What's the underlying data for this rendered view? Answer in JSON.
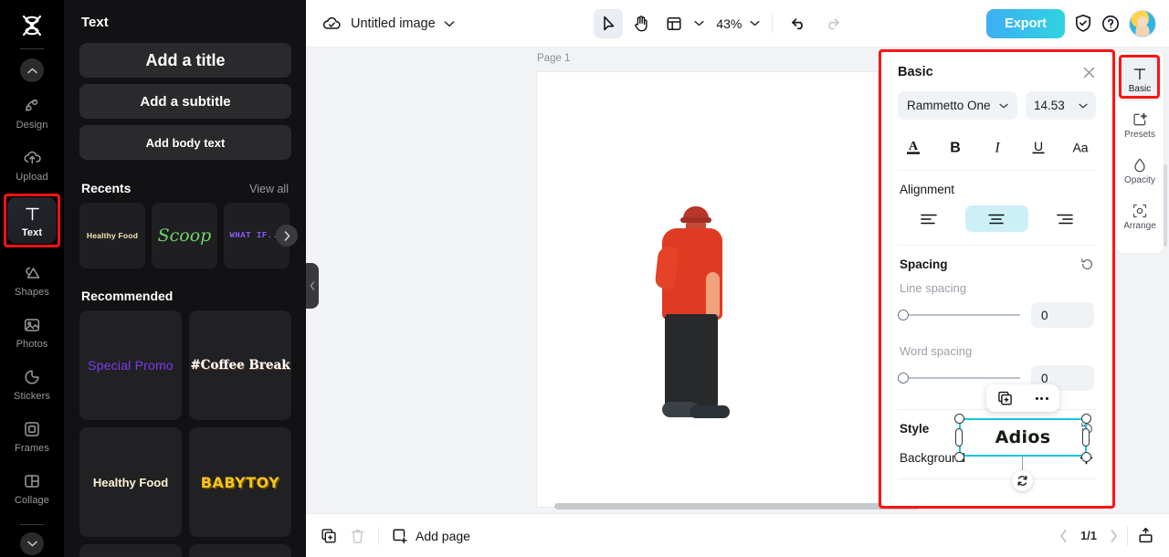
{
  "app": {
    "logo_icon": "capcut-logo-icon"
  },
  "left_rail": {
    "collapse_up_icon": "chevron-up-icon",
    "collapse_down_icon": "chevron-down-icon",
    "items": [
      {
        "label": "Design",
        "icon": "design-icon"
      },
      {
        "label": "Upload",
        "icon": "upload-cloud-icon"
      },
      {
        "label": "Text",
        "icon": "text-T-icon",
        "active": true,
        "highlighted": true
      },
      {
        "label": "Shapes",
        "icon": "shapes-icon"
      },
      {
        "label": "Photos",
        "icon": "photos-image-icon"
      },
      {
        "label": "Stickers",
        "icon": "stickers-icon"
      },
      {
        "label": "Frames",
        "icon": "frames-icon"
      },
      {
        "label": "Collage",
        "icon": "collage-icon"
      }
    ]
  },
  "text_panel": {
    "title": "Text",
    "buttons": [
      {
        "label": "Add a title"
      },
      {
        "label": "Add a subtitle"
      },
      {
        "label": "Add body text"
      }
    ],
    "recents": {
      "title": "Recents",
      "view_all": "View all",
      "next_icon": "chevron-right-icon",
      "items": [
        {
          "label": "Healthy Food",
          "color": "#f7e6b0"
        },
        {
          "label": "Scoop",
          "color": "#72d36b"
        },
        {
          "label": "WHAT IF...",
          "color": "#8b5cf6"
        }
      ]
    },
    "recommended": {
      "title": "Recommended",
      "items": [
        {
          "label": "Special Promo",
          "color": "#7c3aed"
        },
        {
          "label": "#Coffee Break",
          "color": "#ffffff"
        },
        {
          "label": "Healthy Food",
          "color": "#fdf3d0"
        },
        {
          "label": "BABYTOY",
          "color": "#f5c518"
        }
      ]
    },
    "collapse_icon": "chevron-left-icon"
  },
  "topbar": {
    "cloud_icon": "cloud-check-icon",
    "doc_title": "Untitled image",
    "title_chevron_icon": "chevron-down-icon",
    "tools": [
      {
        "name": "select-tool",
        "icon": "cursor-arrow-icon",
        "selected": true
      },
      {
        "name": "hand-tool",
        "icon": "hand-icon",
        "selected": false
      },
      {
        "name": "layout-tool",
        "icon": "layout-panel-icon",
        "selected": false
      }
    ],
    "layout_chevron_icon": "chevron-down-icon",
    "zoom_value": "43%",
    "zoom_chevron_icon": "chevron-down-icon",
    "undo_icon": "undo-arrow-icon",
    "redo_icon": "redo-arrow-icon",
    "export_label": "Export",
    "shield_icon": "shield-check-icon",
    "help_icon": "question-circle-icon",
    "avatar_name": "user-avatar"
  },
  "canvas": {
    "page_label": "Page 1",
    "selected_text": "Adios",
    "floating_toolbar": {
      "duplicate_icon": "duplicate-icon",
      "more_icon": "more-dots-icon"
    },
    "rotate_icon": "rotate-icon"
  },
  "bottombar": {
    "duplicate_page_icon": "duplicate-page-icon",
    "delete_page_icon": "trash-icon",
    "add_page_icon": "add-page-icon",
    "add_page_label": "Add page",
    "prev_icon": "chevron-left-icon",
    "page_indicator": "1/1",
    "next_icon": "chevron-right-icon",
    "present_icon": "present-icon"
  },
  "properties_panel": {
    "title": "Basic",
    "close_icon": "close-x-icon",
    "font_family": "Rammetto One",
    "font_family_chevron": "chevron-down-icon",
    "font_size": "14.53",
    "font_size_chevron": "chevron-down-icon",
    "format_buttons": [
      {
        "name": "text-color-button",
        "label": "A"
      },
      {
        "name": "bold-button",
        "label": "B"
      },
      {
        "name": "italic-button",
        "label": "I"
      },
      {
        "name": "underline-button",
        "label": "U"
      },
      {
        "name": "text-case-button",
        "label": "Aa"
      }
    ],
    "alignment": {
      "label": "Alignment",
      "options": [
        {
          "name": "align-left-button",
          "selected": false
        },
        {
          "name": "align-center-button",
          "selected": true
        },
        {
          "name": "align-right-button",
          "selected": false
        }
      ]
    },
    "spacing": {
      "title": "Spacing",
      "reset_icon": "reset-icon",
      "line_spacing_label": "Line spacing",
      "line_spacing_value": "0",
      "word_spacing_label": "Word spacing",
      "word_spacing_value": "0"
    },
    "style": {
      "title": "Style",
      "reset_icon": "reset-icon",
      "background_label": "Background",
      "add_icon": "plus-icon"
    },
    "highlight_color": "#ff1313"
  },
  "right_rail": {
    "items": [
      {
        "label": "Basic",
        "icon": "text-T-icon",
        "active": true,
        "highlighted": true
      },
      {
        "label": "Presets",
        "icon": "presets-icon",
        "active": false
      },
      {
        "label": "Opacity",
        "icon": "opacity-drop-icon",
        "active": false
      },
      {
        "label": "Arrange",
        "icon": "arrange-icon",
        "active": false
      }
    ]
  }
}
